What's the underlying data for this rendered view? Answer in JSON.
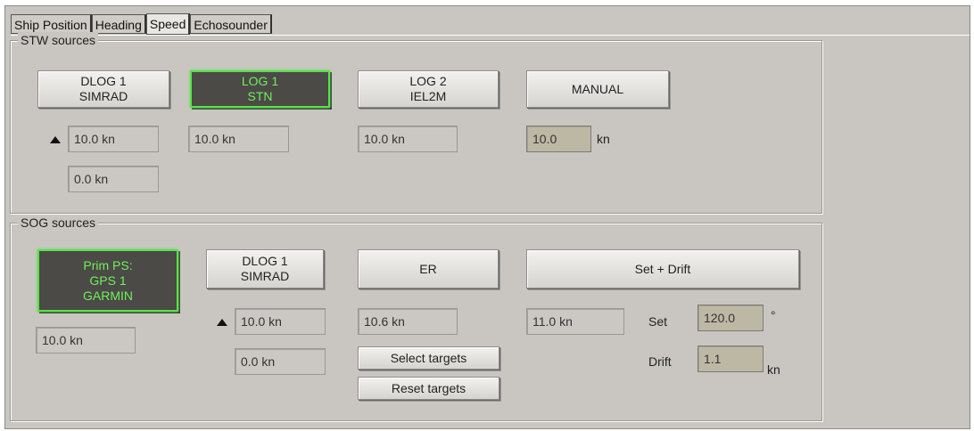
{
  "tabs": [
    "Ship Position",
    "Heading",
    "Speed",
    "Echosounder"
  ],
  "active_tab": "Speed",
  "stw": {
    "title": "STW sources",
    "dlog1": {
      "line1": "DLOG 1",
      "line2": "SIMRAD",
      "speed": "10.0 kn",
      "speed2": "0.0 kn"
    },
    "log1": {
      "line1": "LOG 1",
      "line2": "STN",
      "speed": "10.0 kn"
    },
    "log2": {
      "line1": "LOG 2",
      "line2": "IEL2M",
      "speed": "10.0 kn"
    },
    "manual": {
      "label": "MANUAL",
      "value": "10.0",
      "unit": "kn"
    }
  },
  "sog": {
    "title": "SOG sources",
    "prim": {
      "line1": "Prim PS:",
      "line2": "GPS 1",
      "line3": "GARMIN",
      "speed": "10.0 kn"
    },
    "dlog1": {
      "line1": "DLOG 1",
      "line2": "SIMRAD",
      "speed": "10.0 kn",
      "speed2": "0.0 kn"
    },
    "er": {
      "label": "ER",
      "speed": "10.6 kn",
      "select_targets": "Select targets",
      "reset_targets": "Reset targets"
    },
    "setdrift": {
      "label": "Set + Drift",
      "speed": "11.0 kn",
      "set_label": "Set",
      "set_value": "120.0",
      "set_unit": "°",
      "drift_label": "Drift",
      "drift_value": "1.1",
      "drift_unit": "kn"
    }
  },
  "colors": {
    "active_border": "#59e14a",
    "active_text": "#6ef15c",
    "panel": "#c9c6c1",
    "edit_field": "#bdb8a4"
  }
}
